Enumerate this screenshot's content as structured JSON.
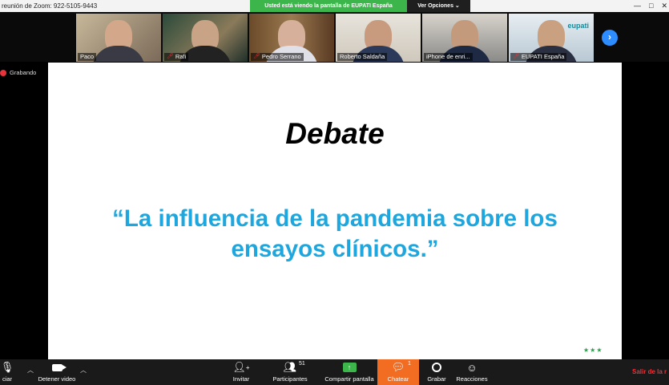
{
  "window": {
    "title": "reunión de Zoom: 922-5105-9443",
    "controls": [
      "—",
      "□",
      "✕"
    ]
  },
  "share_bar": {
    "message": "Usted está viendo la pantalla de EUPATI España",
    "options_label": "Ver Opciones ⌄"
  },
  "participants": [
    {
      "name": "Paco",
      "muted": false
    },
    {
      "name": "Rafi",
      "muted": true
    },
    {
      "name": "Pedro Serrano",
      "muted": true
    },
    {
      "name": "Roberto Saldaña",
      "muted": false
    },
    {
      "name": "iPhone de enri...",
      "muted": false
    },
    {
      "name": "EUPATI España",
      "muted": true
    }
  ],
  "thumb_overlay_text": "eupati",
  "recording_label": "Grabando",
  "slide": {
    "title": "Debate",
    "quote": "“La influencia de la pandemia sobre los ensayos clínicos.”",
    "stars": "★★★"
  },
  "toolbar": {
    "audio_label": "ciar",
    "video_label": "Detener video",
    "invite_label": "Invitar",
    "participants_label": "Participantes",
    "participants_count": "51",
    "share_label": "Compartir pantalla",
    "chat_label": "Chatear",
    "chat_badge": "1",
    "record_label": "Grabar",
    "reactions_label": "Reacciones",
    "leave_label": "Salir de la r"
  },
  "colors": {
    "accent_green": "#3cb54a",
    "zoom_blue": "#2d8cff",
    "slide_quote": "#1ea7df",
    "chat_orange": "#f26c21",
    "danger_red": "#e8333a"
  }
}
